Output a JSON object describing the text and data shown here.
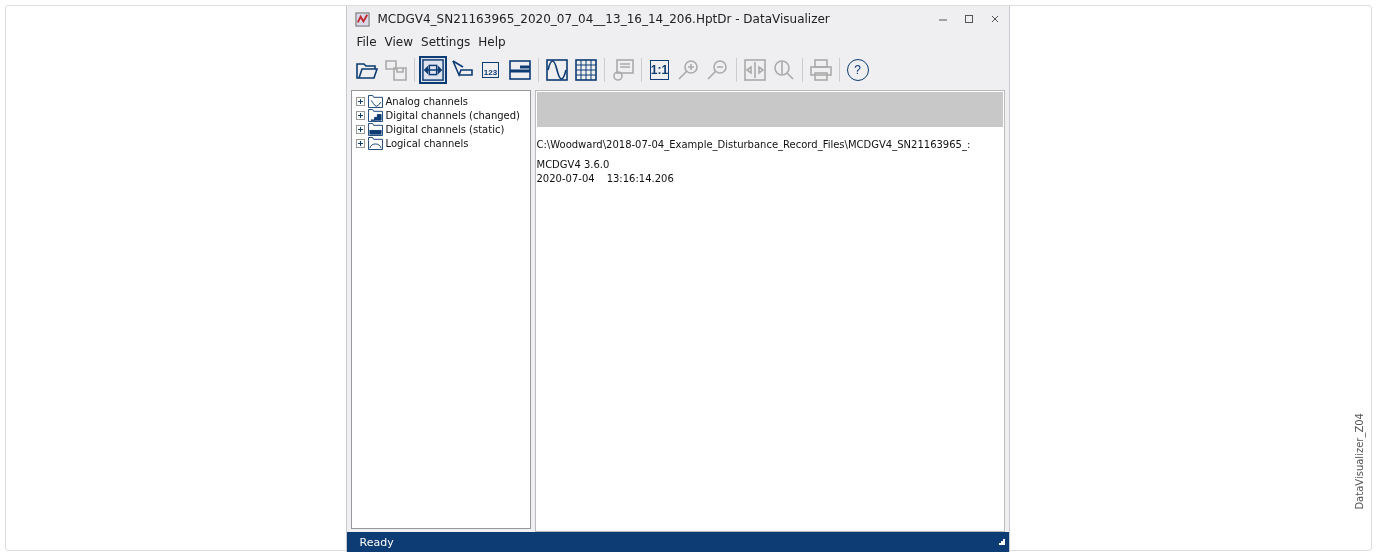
{
  "window": {
    "title": "MCDGV4_SN21163965_2020_07_04__13_16_14_206.HptDr - DataVisualizer"
  },
  "menu": [
    "File",
    "View",
    "Settings",
    "Help"
  ],
  "toolbar": [
    {
      "kind": "open",
      "disabled": false,
      "pressed": false
    },
    {
      "kind": "save",
      "disabled": true,
      "pressed": false
    },
    {
      "kind": "sep"
    },
    {
      "kind": "fit",
      "disabled": false,
      "pressed": true
    },
    {
      "kind": "pointer",
      "disabled": false,
      "pressed": false
    },
    {
      "kind": "numbers",
      "disabled": false,
      "pressed": false,
      "label": "123"
    },
    {
      "kind": "bars",
      "disabled": false,
      "pressed": false
    },
    {
      "kind": "sep"
    },
    {
      "kind": "wave",
      "disabled": false,
      "pressed": false
    },
    {
      "kind": "grid",
      "disabled": false,
      "pressed": false
    },
    {
      "kind": "sep"
    },
    {
      "kind": "note",
      "disabled": true,
      "pressed": false
    },
    {
      "kind": "sep"
    },
    {
      "kind": "scale",
      "disabled": false,
      "pressed": false,
      "label": "1:1"
    },
    {
      "kind": "zoomin",
      "disabled": true,
      "pressed": false
    },
    {
      "kind": "zoomout",
      "disabled": true,
      "pressed": false
    },
    {
      "kind": "sep"
    },
    {
      "kind": "split",
      "disabled": true,
      "pressed": false
    },
    {
      "kind": "zoomfit",
      "disabled": true,
      "pressed": false
    },
    {
      "kind": "sep"
    },
    {
      "kind": "print",
      "disabled": true,
      "pressed": false
    },
    {
      "kind": "sep"
    },
    {
      "kind": "help",
      "disabled": false,
      "pressed": false,
      "label": "?"
    }
  ],
  "tree": [
    {
      "label": "Analog channels",
      "kind": "analog",
      "expanded": false
    },
    {
      "label": "Digital channels (changed)",
      "kind": "changed",
      "expanded": false
    },
    {
      "label": "Digital channels (static)",
      "kind": "static",
      "expanded": false
    },
    {
      "label": "Logical channels",
      "kind": "logical",
      "expanded": false
    }
  ],
  "info": {
    "path": "C:\\Woodward\\2018-07-04_Example_Disturbance_Record_Files\\MCDGV4_SN21163965_:",
    "version": "MCDGV4 3.6.0",
    "date": "2020-07-04",
    "time": "13:16:14.206"
  },
  "status_bar": {
    "text": "Ready"
  },
  "figure_id": "DataVisualizer_Z04"
}
